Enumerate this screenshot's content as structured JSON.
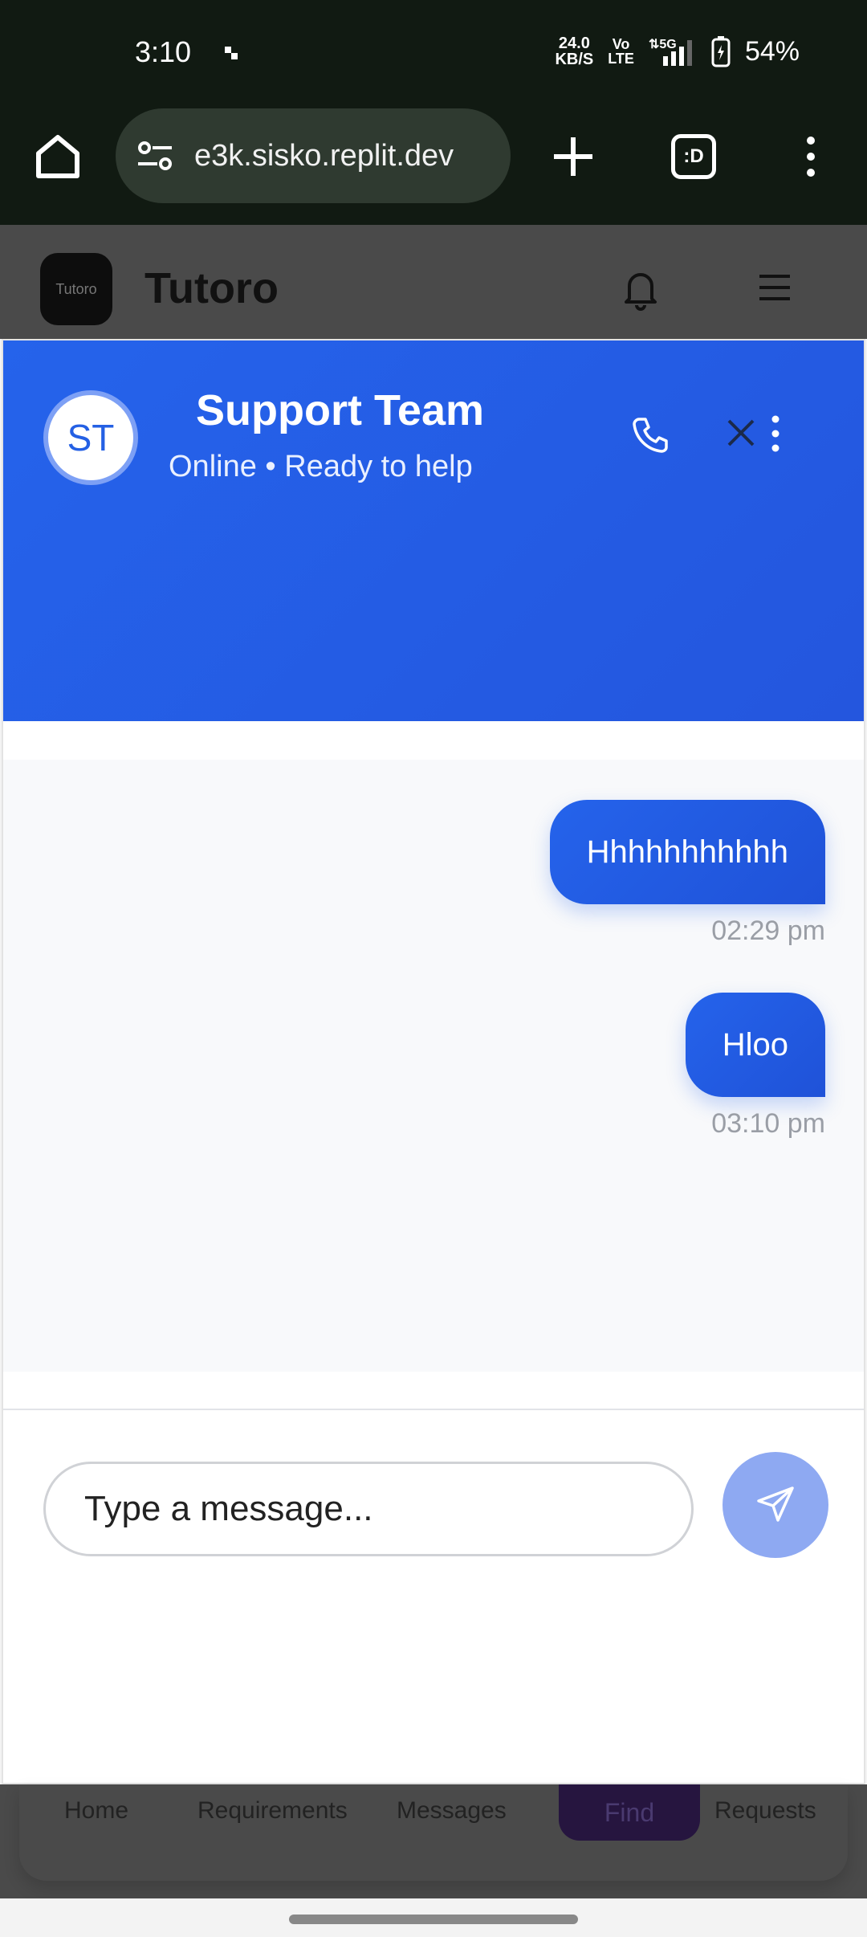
{
  "status_bar": {
    "time": "3:10",
    "net_speed": "24.0",
    "net_unit": "KB/S",
    "volte_top": "Vo",
    "volte_bottom": "LTE",
    "signal": "5G",
    "battery": "54%"
  },
  "browser": {
    "url": "e3k.sisko.replit.dev",
    "tabs_label": ":D"
  },
  "app": {
    "title": "Tutoro",
    "logo_text": "Tutoro"
  },
  "chat": {
    "avatar_initials": "ST",
    "name": "Support Team",
    "status": "Online • Ready to help",
    "messages": [
      {
        "text": "Hhhhhhhhhhh",
        "time": "02:29 pm"
      },
      {
        "text": "Hloo",
        "time": "03:10 pm"
      }
    ],
    "input_placeholder": "Type a message...",
    "accent_color": "#2563eb"
  },
  "bottom_nav": {
    "items": [
      "Home",
      "Requirements",
      "Messages",
      "Find",
      "Requests"
    ]
  }
}
